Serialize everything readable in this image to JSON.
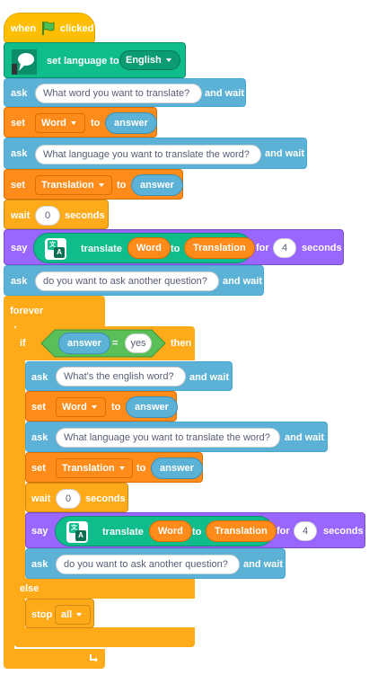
{
  "hat": {
    "when": "when",
    "clicked": "clicked"
  },
  "set_language": {
    "label": "set language to",
    "value": "English"
  },
  "top": {
    "ask1": {
      "ask": "ask",
      "text": "What word you want to translate?",
      "wait": "and wait"
    },
    "set1": {
      "set": "set",
      "var": "Word",
      "to": "to",
      "value": "answer"
    },
    "ask2": {
      "ask": "ask",
      "text": "What language you want to translate the word?",
      "wait": "and wait"
    },
    "set2": {
      "set": "set",
      "var": "Translation",
      "to": "to",
      "value": "answer"
    },
    "wait": {
      "wait": "wait",
      "value": "0",
      "seconds": "seconds"
    },
    "say": {
      "say": "say",
      "translate": "translate",
      "word": "Word",
      "to": "to",
      "lang": "Translation",
      "for": "for",
      "secs": "4",
      "seconds": "seconds"
    },
    "ask3": {
      "ask": "ask",
      "text": "do you want to ask another question?",
      "wait": "and wait"
    }
  },
  "forever": {
    "label": "forever"
  },
  "if": {
    "if": "if",
    "left": "answer",
    "op": "=",
    "right": "yes",
    "then": "then"
  },
  "inner": {
    "ask1": {
      "ask": "ask",
      "text": "What's  the english word?",
      "wait": "and wait"
    },
    "set1": {
      "set": "set",
      "var": "Word",
      "to": "to",
      "value": "answer"
    },
    "ask2": {
      "ask": "ask",
      "text": "What language you want to translate the word?",
      "wait": "and wait"
    },
    "set2": {
      "set": "set",
      "var": "Translation",
      "to": "to",
      "value": "answer"
    },
    "wait": {
      "wait": "wait",
      "value": "0",
      "seconds": "seconds"
    },
    "say": {
      "say": "say",
      "translate": "translate",
      "word": "Word",
      "to": "to",
      "lang": "Translation",
      "for": "for",
      "secs": "4",
      "seconds": "seconds"
    },
    "ask3": {
      "ask": "ask",
      "text": "do you want to ask another question?",
      "wait": "and wait"
    }
  },
  "else": {
    "label": "else"
  },
  "stop": {
    "label": "stop",
    "value": "all"
  },
  "colors": {
    "events": "#ffbf00",
    "control": "#ffab19",
    "sensing": "#5cb1d6",
    "variables": "#ff8c1a",
    "looks": "#9966ff",
    "extension": "#0fbd8c"
  }
}
